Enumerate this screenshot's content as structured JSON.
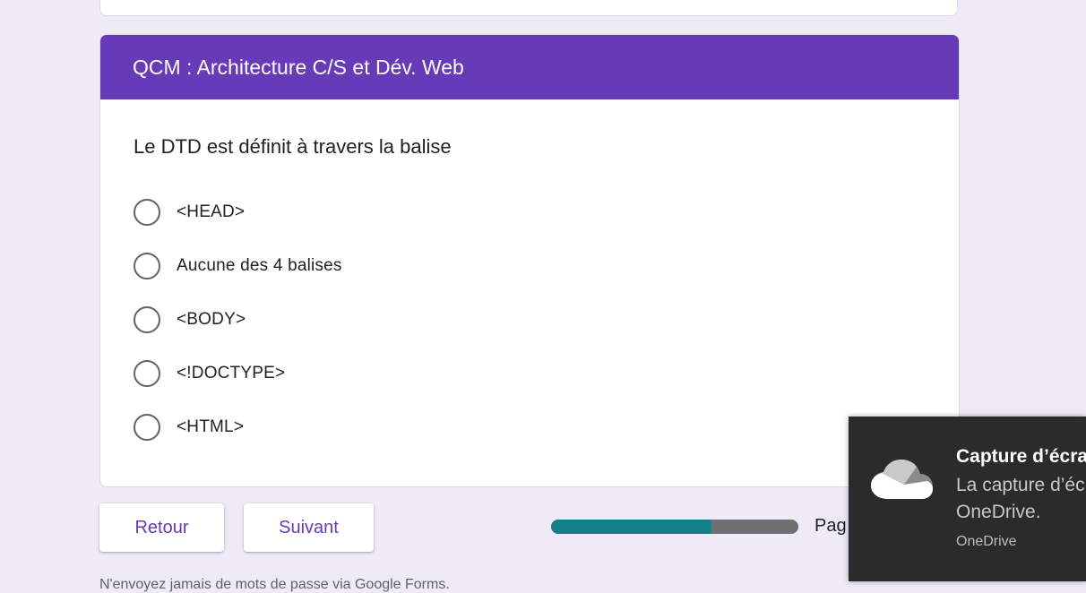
{
  "section": {
    "title": "QCM : Architecture C/S et Dév. Web"
  },
  "question": {
    "text": "Le DTD est définit à travers la balise",
    "options": [
      {
        "label": "<HEAD>"
      },
      {
        "label": "Aucune des 4 balises"
      },
      {
        "label": "<BODY>"
      },
      {
        "label": "<!DOCTYPE>"
      },
      {
        "label": "<HTML>"
      }
    ]
  },
  "navigation": {
    "back_label": "Retour",
    "next_label": "Suivant",
    "progress_fraction": 0.65,
    "page_label_visible": "Pag"
  },
  "footer": {
    "note": "N'envoyez jamais de mots de passe via Google Forms."
  },
  "toast": {
    "title": "Capture d’écran",
    "body_line1": "La capture d’écran",
    "body_line2": "OneDrive.",
    "source": "OneDrive",
    "icon": "onedrive-cloud-icon"
  },
  "colors": {
    "accent": "#673ab7",
    "background": "#efeaf7",
    "progress_fill": "#15818a",
    "progress_track": "#6d6f73",
    "toast_bg": "#2b2b2b"
  }
}
